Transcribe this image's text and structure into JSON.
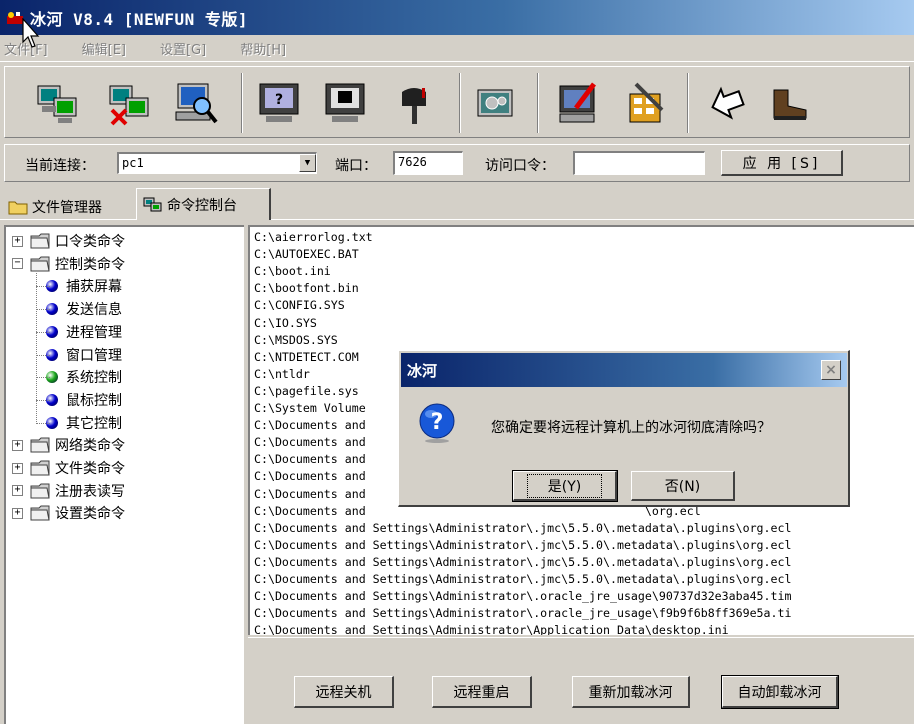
{
  "window": {
    "title": "冰河 V8.4 [NEWFUN 专版]"
  },
  "menu": [
    "文件[F]",
    "编辑[E]",
    "设置[G]",
    "帮助[H]"
  ],
  "connection": {
    "current_label": "当前连接：",
    "current_value": "pc1",
    "port_label": "端口：",
    "port_value": "7626",
    "password_label": "访问口令：",
    "password_value": "",
    "apply_label": "应 用 [S]"
  },
  "tabs": [
    {
      "label": "文件管理器",
      "active": false
    },
    {
      "label": "命令控制台",
      "active": true
    }
  ],
  "tree": [
    {
      "label": "口令类命令",
      "level": 0,
      "expander": "+"
    },
    {
      "label": "控制类命令",
      "level": 0,
      "expander": "-"
    },
    {
      "label": "捕获屏幕",
      "level": 1,
      "color": "#0000cc"
    },
    {
      "label": "发送信息",
      "level": 1,
      "color": "#0000cc"
    },
    {
      "label": "进程管理",
      "level": 1,
      "color": "#0000cc"
    },
    {
      "label": "窗口管理",
      "level": 1,
      "color": "#0000cc"
    },
    {
      "label": "系统控制",
      "level": 1,
      "color": "#1aa81a"
    },
    {
      "label": "鼠标控制",
      "level": 1,
      "color": "#0000cc"
    },
    {
      "label": "其它控制",
      "level": 1,
      "color": "#0000cc"
    },
    {
      "label": "网络类命令",
      "level": 0,
      "expander": "+"
    },
    {
      "label": "文件类命令",
      "level": 0,
      "expander": "+"
    },
    {
      "label": "注册表读写",
      "level": 0,
      "expander": "+"
    },
    {
      "label": "设置类命令",
      "level": 0,
      "expander": "+"
    }
  ],
  "console_lines": [
    "C:\\aierrorlog.txt",
    "C:\\AUTOEXEC.BAT",
    "C:\\boot.ini",
    "C:\\bootfont.bin",
    "C:\\CONFIG.SYS",
    "C:\\IO.SYS",
    "C:\\MSDOS.SYS",
    "C:\\NTDETECT.COM",
    "C:\\ntldr",
    "C:\\pagefile.sys",
    "C:\\System Volume",
    "C:\\Documents and",
    "C:\\Documents and",
    "C:\\Documents and",
    "C:\\Documents and",
    "C:\\Documents and                                        \\org.ecl",
    "C:\\Documents and                                        \\org.ecl",
    "C:\\Documents and Settings\\Administrator\\.jmc\\5.5.0\\.metadata\\.plugins\\org.ecl",
    "C:\\Documents and Settings\\Administrator\\.jmc\\5.5.0\\.metadata\\.plugins\\org.ecl",
    "C:\\Documents and Settings\\Administrator\\.jmc\\5.5.0\\.metadata\\.plugins\\org.ecl",
    "C:\\Documents and Settings\\Administrator\\.jmc\\5.5.0\\.metadata\\.plugins\\org.ecl",
    "C:\\Documents and Settings\\Administrator\\.oracle_jre_usage\\90737d32e3aba45.tim",
    "C:\\Documents and Settings\\Administrator\\.oracle_jre_usage\\f9b9f6b8ff369e5a.ti",
    "C:\\Documents and Settings\\Administrator\\Application Data\\desktop.ini"
  ],
  "commands": [
    "远程关机",
    "远程重启",
    "重新加载冰河",
    "自动卸载冰河"
  ],
  "dialog": {
    "title": "冰河",
    "message": "您确定要将远程计算机上的冰河彻底清除吗？",
    "yes_label": "是(Y)",
    "no_label": "否(N)",
    "close_glyph": "×"
  },
  "icons": [
    "add-host-icon",
    "delete-host-icon",
    "search-host-icon",
    "capture-screen-icon",
    "screen-control-icon",
    "mailbox-icon",
    "settings-panel-icon",
    "monitor-pen-icon",
    "config-tools-icon",
    "connect-icon",
    "exit-icon"
  ],
  "colors": {
    "title_gradient_start": "#0a246a",
    "title_gradient_end": "#a6caf0",
    "window_bg": "#d4d0c8"
  }
}
